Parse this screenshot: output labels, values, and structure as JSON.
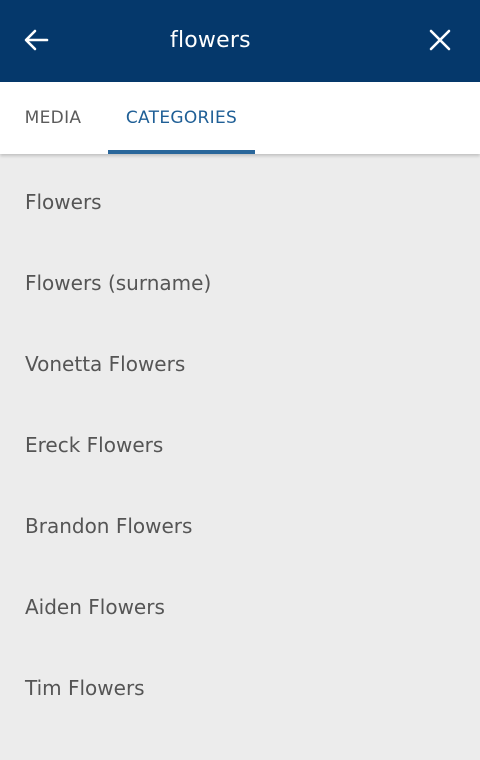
{
  "header": {
    "back_icon": "arrow-left-icon",
    "title": "flowers",
    "close_icon": "close-icon",
    "background_color": "#05386b"
  },
  "tabs": [
    {
      "label": "MEDIA",
      "selected": false
    },
    {
      "label": "CATEGORIES",
      "selected": true
    }
  ],
  "accent_color": "#2a679b",
  "results": [
    "Flowers",
    "Flowers (surname)",
    "Vonetta Flowers",
    "Ereck Flowers",
    "Brandon Flowers",
    "Aiden Flowers",
    "Tim Flowers"
  ]
}
